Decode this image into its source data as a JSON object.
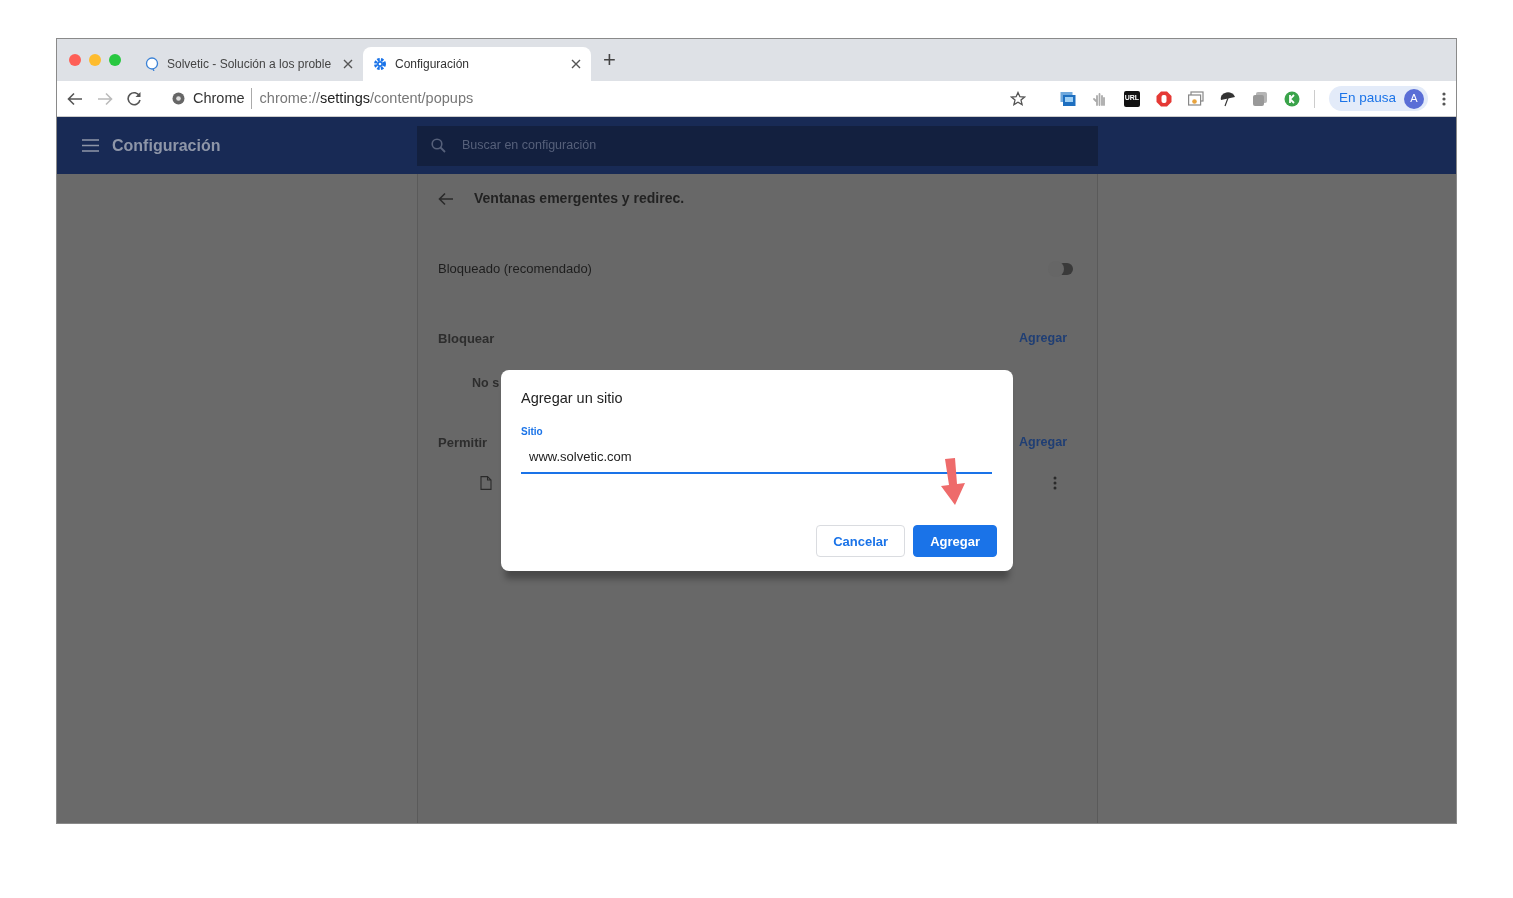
{
  "tabs": [
    {
      "title": "Solvetic - Solución a los proble",
      "kind": "bubble",
      "selected": false
    },
    {
      "title": "Configuración",
      "kind": "gear",
      "selected": true
    }
  ],
  "new_tab": "+",
  "toolbar": {
    "site_label": "Chrome",
    "url_scheme": "chrome://",
    "url_host": "settings",
    "url_path": "/content/popups",
    "bookmarked": false,
    "extensions": [
      {
        "kind": "image"
      },
      {
        "kind": "hand"
      },
      {
        "kind": "badge",
        "label": "URL"
      },
      {
        "kind": "stop"
      },
      {
        "kind": "windows"
      },
      {
        "kind": "umbrella"
      },
      {
        "kind": "copy"
      },
      {
        "kind": "k"
      }
    ],
    "profile": {
      "label": "En pausa",
      "initial": "A"
    }
  },
  "settings_header": {
    "title": "Configuración",
    "search_placeholder": "Buscar en configuración"
  },
  "page": {
    "title": "Ventanas emergentes y redirec.",
    "toggle": {
      "label": "Bloqueado (recomendado)",
      "on": false
    },
    "sections": [
      {
        "heading": "Bloquear",
        "action": "Agregar",
        "note": "No s"
      },
      {
        "heading": "Permitir",
        "action": "Agregar",
        "has_entry": true
      }
    ]
  },
  "dialog": {
    "title": "Agregar un sitio",
    "field_label": "Sitio",
    "value": "www.solvetic.com",
    "buttons": [
      {
        "label": "Cancelar",
        "kind": "secondary"
      },
      {
        "label": "Agregar",
        "kind": "primary"
      }
    ]
  }
}
